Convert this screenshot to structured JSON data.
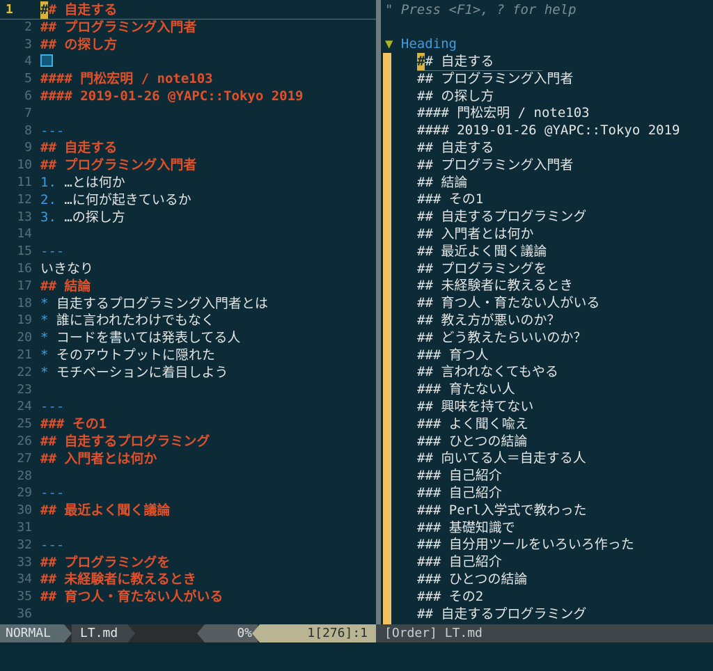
{
  "editor": {
    "lines": [
      {
        "num": "1",
        "kind": "heading",
        "text": "# 自走する",
        "cursor_char": "#",
        "current": true
      },
      {
        "num": "2",
        "kind": "heading",
        "text": "## プログラミング入門者"
      },
      {
        "num": "3",
        "kind": "heading",
        "text": "## の探し方"
      },
      {
        "num": "4",
        "kind": "cursor-square",
        "text": ""
      },
      {
        "num": "5",
        "kind": "heading",
        "text": "#### 門松宏明 / note103"
      },
      {
        "num": "6",
        "kind": "heading",
        "text": "#### 2019-01-26 @YAPC::Tokyo 2019"
      },
      {
        "num": "7",
        "kind": "plain",
        "text": ""
      },
      {
        "num": "8",
        "kind": "hr",
        "text": "---"
      },
      {
        "num": "9",
        "kind": "heading",
        "text": "## 自走する"
      },
      {
        "num": "10",
        "kind": "heading",
        "text": "## プログラミング入門者"
      },
      {
        "num": "11",
        "kind": "olist",
        "marker": "1.",
        "text": " …とは何か"
      },
      {
        "num": "12",
        "kind": "olist",
        "marker": "2.",
        "text": " …に何が起きているか"
      },
      {
        "num": "13",
        "kind": "olist",
        "marker": "3.",
        "text": " …の探し方"
      },
      {
        "num": "14",
        "kind": "plain",
        "text": ""
      },
      {
        "num": "15",
        "kind": "hr",
        "text": "---"
      },
      {
        "num": "16",
        "kind": "plain",
        "text": "いきなり"
      },
      {
        "num": "17",
        "kind": "heading",
        "text": "## 結論"
      },
      {
        "num": "18",
        "kind": "ulist",
        "marker": "*",
        "text": " 自走するプログラミング入門者とは"
      },
      {
        "num": "19",
        "kind": "ulist",
        "marker": "*",
        "text": " 誰に言われたわけでもなく"
      },
      {
        "num": "20",
        "kind": "ulist",
        "marker": "*",
        "text": " コードを書いては発表してる人"
      },
      {
        "num": "21",
        "kind": "ulist",
        "marker": "*",
        "text": " そのアウトプットに隠れた"
      },
      {
        "num": "22",
        "kind": "ulist",
        "marker": "*",
        "text": " モチベーションに着目しよう"
      },
      {
        "num": "23",
        "kind": "plain",
        "text": ""
      },
      {
        "num": "24",
        "kind": "hr",
        "text": "---"
      },
      {
        "num": "25",
        "kind": "heading",
        "text": "### その1"
      },
      {
        "num": "26",
        "kind": "heading",
        "text": "## 自走するプログラミング"
      },
      {
        "num": "27",
        "kind": "heading",
        "text": "## 入門者とは何か"
      },
      {
        "num": "28",
        "kind": "plain",
        "text": ""
      },
      {
        "num": "29",
        "kind": "hr",
        "text": "---"
      },
      {
        "num": "30",
        "kind": "heading",
        "text": "## 最近よく聞く議論"
      },
      {
        "num": "31",
        "kind": "plain",
        "text": ""
      },
      {
        "num": "32",
        "kind": "hr",
        "text": "---"
      },
      {
        "num": "33",
        "kind": "heading",
        "text": "## プログラミングを"
      },
      {
        "num": "34",
        "kind": "heading",
        "text": "## 未経験者に教えるとき"
      },
      {
        "num": "35",
        "kind": "heading",
        "text": "## 育つ人・育たない人がいる"
      },
      {
        "num": "36",
        "kind": "plain",
        "text": ""
      }
    ]
  },
  "tagbar": {
    "help": "\" Press <F1>, ? for help",
    "group_label": "Heading",
    "tags": [
      {
        "text": "# 自走する",
        "cursor_char": "#",
        "current": true
      },
      {
        "text": "## プログラミング入門者"
      },
      {
        "text": "## の探し方"
      },
      {
        "text": "#### 門松宏明 / note103"
      },
      {
        "text": "#### 2019-01-26 @YAPC::Tokyo 2019"
      },
      {
        "text": "## 自走する"
      },
      {
        "text": "## プログラミング入門者"
      },
      {
        "text": "## 結論"
      },
      {
        "text": "### その1"
      },
      {
        "text": "## 自走するプログラミング"
      },
      {
        "text": "## 入門者とは何か"
      },
      {
        "text": "## 最近よく聞く議論"
      },
      {
        "text": "## プログラミングを"
      },
      {
        "text": "## 未経験者に教えるとき"
      },
      {
        "text": "## 育つ人・育たない人がいる"
      },
      {
        "text": "## 教え方が悪いのか？"
      },
      {
        "text": "## どう教えたらいいのか？"
      },
      {
        "text": "### 育つ人"
      },
      {
        "text": "## 言われなくてもやる"
      },
      {
        "text": "### 育たない人"
      },
      {
        "text": "## 興味を持てない"
      },
      {
        "text": "### よく聞く喩え"
      },
      {
        "text": "### ひとつの結論"
      },
      {
        "text": "## 向いてる人＝自走する人"
      },
      {
        "text": "### 自己紹介"
      },
      {
        "text": "### 自己紹介"
      },
      {
        "text": "### Perl入学式で教わった"
      },
      {
        "text": "### 基礎知識で"
      },
      {
        "text": "### 自分用ツールをいろいろ作った"
      },
      {
        "text": "### 自己紹介"
      },
      {
        "text": "### ひとつの結論"
      },
      {
        "text": "### その2"
      },
      {
        "text": "## 自走するプログラミング"
      }
    ]
  },
  "statusline": {
    "mode": "NORMAL",
    "filename": "LT.md",
    "percent": "0%",
    "position": "1[276]:1",
    "right_label": "[Order] LT.md"
  },
  "colors": {
    "background": "#0d2b37",
    "heading": "#e0512a",
    "hr": "#3d8fd0",
    "fold_bar": "#f2c265",
    "cursor": "#d9b340"
  }
}
